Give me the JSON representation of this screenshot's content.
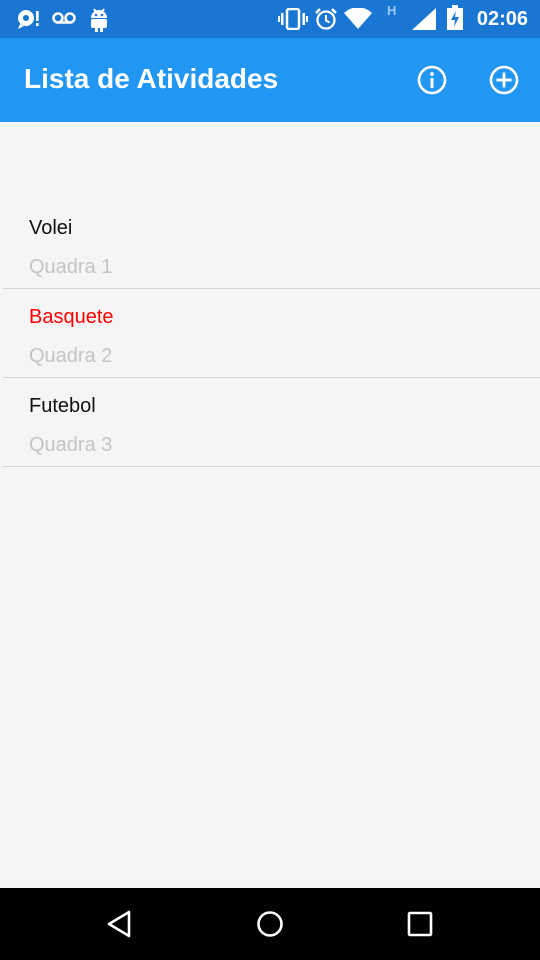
{
  "status_bar": {
    "time": "02:06",
    "icons": [
      "notification-bubble-icon",
      "voicemail-icon",
      "android-debug-icon",
      "vibrate-icon",
      "alarm-icon",
      "wifi-icon",
      "network-type-h-icon",
      "signal-icon",
      "battery-charging-icon"
    ],
    "network_type": "H"
  },
  "app_bar": {
    "title": "Lista de Atividades",
    "actions": [
      "info-icon",
      "add-circle-icon"
    ]
  },
  "activities": [
    {
      "title": "Volei",
      "subtitle": "Quadra 1",
      "highlighted": false
    },
    {
      "title": "Basquete",
      "subtitle": "Quadra 2",
      "highlighted": true
    },
    {
      "title": "Futebol",
      "subtitle": "Quadra 3",
      "highlighted": false
    }
  ],
  "nav_bar": {
    "buttons": [
      "back-icon",
      "home-icon",
      "recents-icon"
    ]
  },
  "colors": {
    "status_bar": "#1976d2",
    "app_bar": "#2196f3",
    "background": "#f5f5f5",
    "highlight_text": "#ff0000",
    "subtitle_text": "#c4c4c4"
  }
}
